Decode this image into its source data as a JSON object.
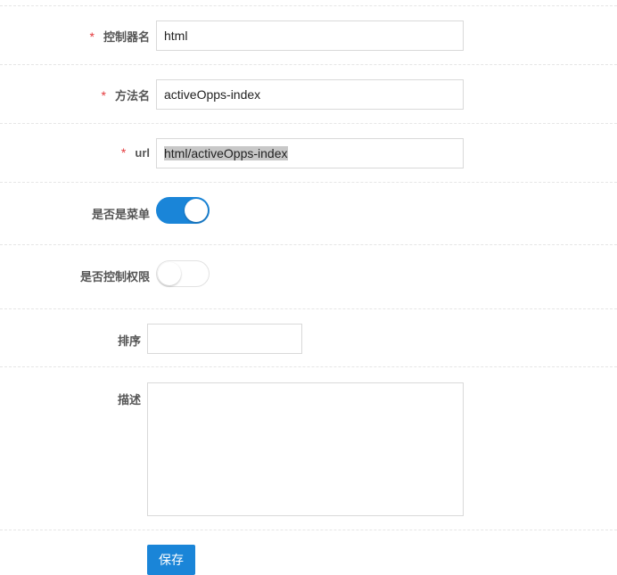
{
  "form": {
    "controller_name": {
      "label": "控制器名",
      "required_mark": "*",
      "value": "html"
    },
    "method_name": {
      "label": "方法名",
      "required_mark": "*",
      "value": "activeOpps-index"
    },
    "url": {
      "label": "url",
      "required_mark": "*",
      "value": "html/activeOpps-index"
    },
    "is_menu": {
      "label": "是否是菜单",
      "checked": true
    },
    "is_permission": {
      "label": "是否控制权限",
      "checked": false
    },
    "sort": {
      "label": "排序",
      "value": ""
    },
    "description": {
      "label": "描述",
      "value": ""
    },
    "save_label": "保存"
  },
  "colors": {
    "accent": "#1a85d8",
    "required": "#e4393c",
    "divider": "#e6e6e6",
    "input_border": "#d9d9d9"
  }
}
